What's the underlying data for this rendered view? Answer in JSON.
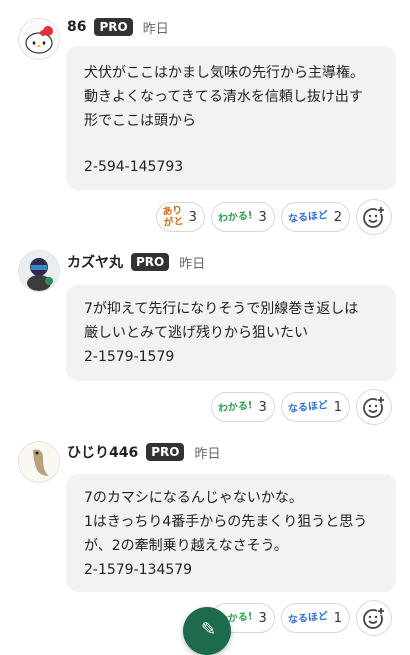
{
  "posts": [
    {
      "username": "86",
      "badge": "PRO",
      "time": "昨日",
      "avatar_icon": "hello-kitty-avatar",
      "lines": [
        "犬伏がここはかまし気味の先行から主導権。",
        "動きよくなってきてる清水を信頼し抜け出す",
        "形でここは頭から",
        "",
        "2-594-145793"
      ],
      "reactions": [
        {
          "label_top": "あり",
          "label_bottom": "がと",
          "count": "3"
        },
        {
          "label": "わかる!",
          "count": "3"
        },
        {
          "label": "なるほど",
          "count": "2"
        }
      ]
    },
    {
      "username": "カズヤ丸",
      "badge": "PRO",
      "time": "昨日",
      "avatar_icon": "character-avatar",
      "lines": [
        "7が抑えて先行になりそうで別線巻き返しは",
        "厳しいとみて逃げ残りから狙いたい",
        "2-1579-1579"
      ],
      "reactions": [
        {
          "label": "わかる!",
          "count": "3"
        },
        {
          "label": "なるほど",
          "count": "1"
        }
      ]
    },
    {
      "username": "ひじり446",
      "badge": "PRO",
      "time": "昨日",
      "avatar_icon": "fish-avatar",
      "lines": [
        "7のカマシになるんじゃないかな。",
        "1はきっちり4番手からの先まくり狙うと思う",
        "が、2の牽制乗り越えなさそう。",
        "2-1579-134579"
      ],
      "reactions": [
        {
          "label": "わかる!",
          "count": "3"
        },
        {
          "label": "なるほど",
          "count": "1"
        }
      ]
    }
  ],
  "colors": {
    "accent_green": "#1d6b4c",
    "wakaru": "#2e9b4f",
    "naruhodo": "#2e6fd6",
    "arigato": "#d2691e"
  }
}
